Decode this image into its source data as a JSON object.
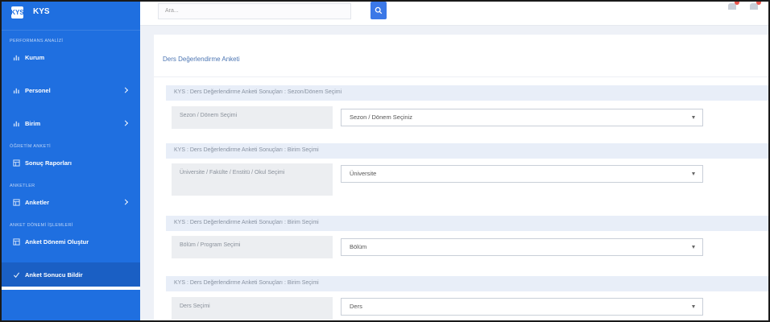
{
  "brand": {
    "logo": "KYS",
    "title": "KYS"
  },
  "sidebar": {
    "sections": [
      {
        "title": "PERFORMANS ANALİZİ",
        "items": [
          {
            "label": "Kurum",
            "icon": "chart-icon",
            "has_children": false
          }
        ]
      },
      {
        "title": "",
        "items": [
          {
            "label": "Personel",
            "icon": "chart-icon",
            "has_children": true
          },
          {
            "label": "Birim",
            "icon": "chart-icon",
            "has_children": true
          }
        ]
      },
      {
        "title": "ÖĞRETİM ANKETİ",
        "items": [
          {
            "label": "Sonuç Raporları",
            "icon": "grid-icon",
            "has_children": false
          }
        ]
      },
      {
        "title": "ANKETLER",
        "items": [
          {
            "label": "Anketler",
            "icon": "grid-icon",
            "has_children": true
          }
        ]
      },
      {
        "title": "ANKET DÖNEMİ İŞLEMLERİ",
        "items": [
          {
            "label": "Anket Dönemi Oluştur",
            "icon": "grid-icon",
            "has_children": false
          },
          {
            "label": "Anket Sonucu Bildir",
            "icon": "check-icon",
            "has_children": false
          }
        ]
      }
    ]
  },
  "topbar": {
    "search_placeholder": "Ara...",
    "search_icon": "search-icon"
  },
  "page": {
    "card_title": "Ders Değerlendirme Anketi",
    "blocks": [
      {
        "heading": "KYS : Ders Değerlendirme Anketi Sonuçları : Sezon/Dönem Seçimi",
        "label": "Sezon / Dönem Seçimi",
        "value": "Sezon / Dönem Seçiniz"
      },
      {
        "heading": "KYS : Ders Değerlendirme Anketi Sonuçları : Birim Seçimi",
        "label": "Üniversite / Fakülte / Enstitü / Okul Seçimi",
        "value": "Üniversite"
      },
      {
        "heading": "KYS : Ders Değerlendirme Anketi Sonuçları : Birim Seçimi",
        "label": "Bölüm / Program Seçimi",
        "value": "Bölüm"
      },
      {
        "heading": "KYS : Ders Değerlendirme Anketi Sonuçları : Birim Seçimi",
        "label": "Ders Seçimi",
        "value": "Ders"
      }
    ]
  },
  "colors": {
    "sidebar": "#1f6fe0",
    "accent": "#3b78e7",
    "block_head": "#e8eef8",
    "background": "#eef1f7"
  }
}
